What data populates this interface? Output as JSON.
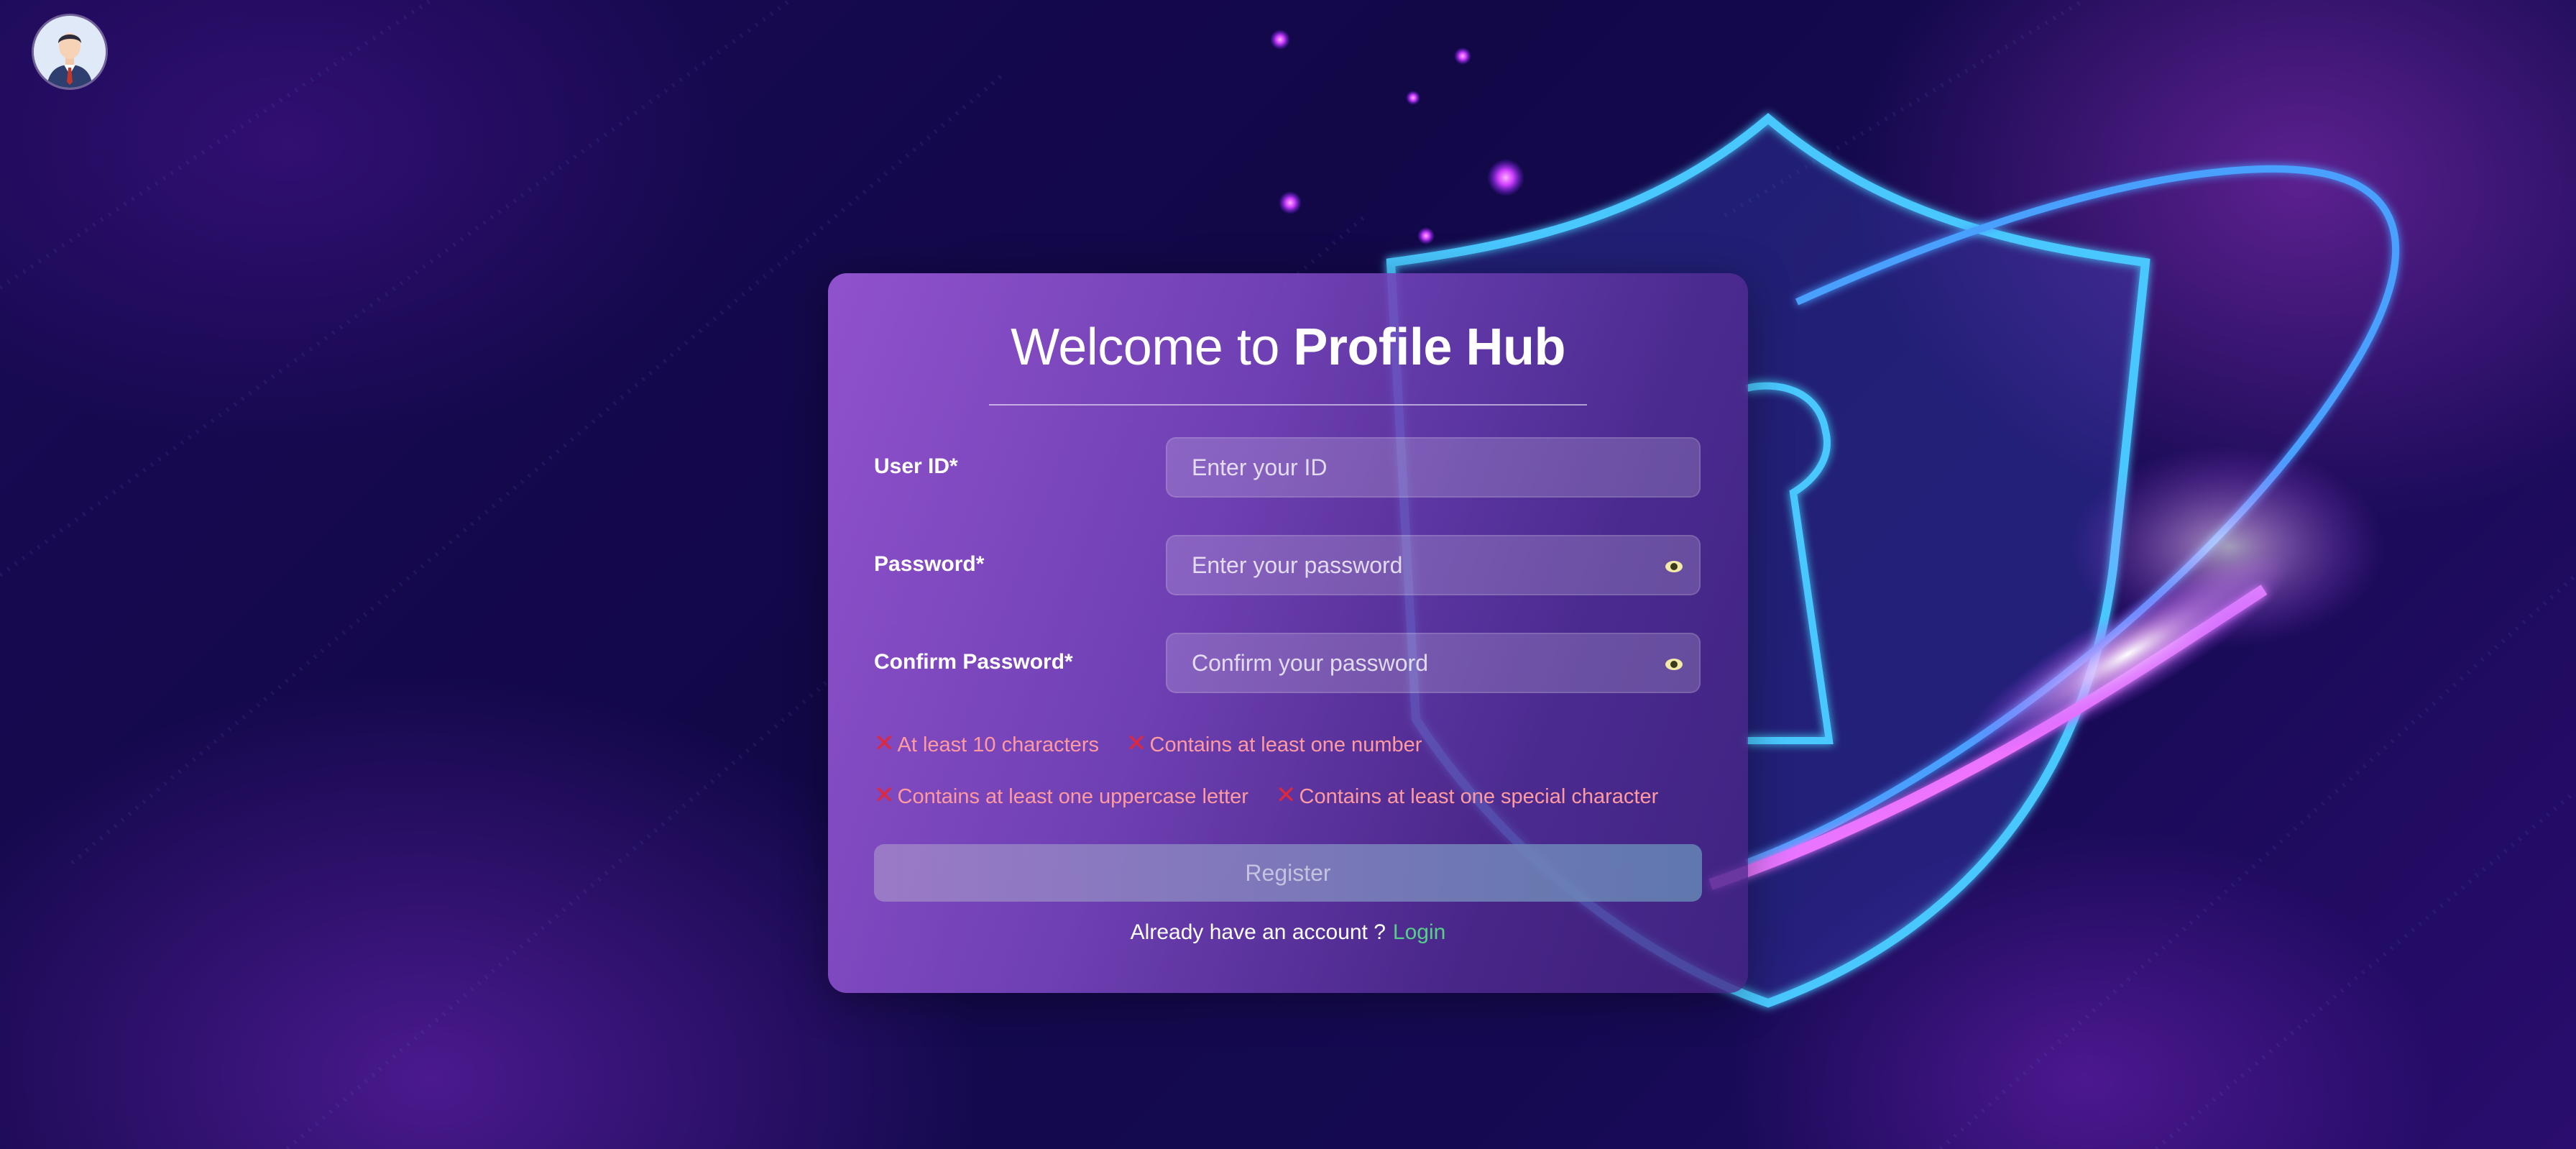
{
  "page": {
    "title_prefix": "Welcome to",
    "title_brand": "Profile Hub"
  },
  "form": {
    "user_id": {
      "label": "User ID*",
      "placeholder": "Enter your ID"
    },
    "password": {
      "label": "Password*",
      "placeholder": "Enter your password"
    },
    "confirm_password": {
      "label": "Confirm Password*",
      "placeholder": "Confirm your password"
    }
  },
  "rules": [
    {
      "icon": "red-x-icon",
      "text": "At least 10 characters",
      "met": false
    },
    {
      "icon": "red-x-icon",
      "text": "Contains at least one number",
      "met": false
    },
    {
      "icon": "red-x-icon",
      "text": "Contains at least one uppercase letter",
      "met": false
    },
    {
      "icon": "red-x-icon",
      "text": "Contains at least one special character",
      "met": false
    }
  ],
  "actions": {
    "register_label": "Register",
    "account_prompt": "Already have an account ?",
    "login_label": "Login"
  },
  "icons": {
    "avatar": "businessman-avatar-icon",
    "password_toggle": "eye-icon",
    "rule_fail": "✕"
  },
  "colors": {
    "rule_text": "#ff9aa0",
    "rule_icon": "#e0283c",
    "login_link": "#56d089",
    "card_gradient_start": "#9655d2",
    "card_gradient_end": "#462382"
  }
}
